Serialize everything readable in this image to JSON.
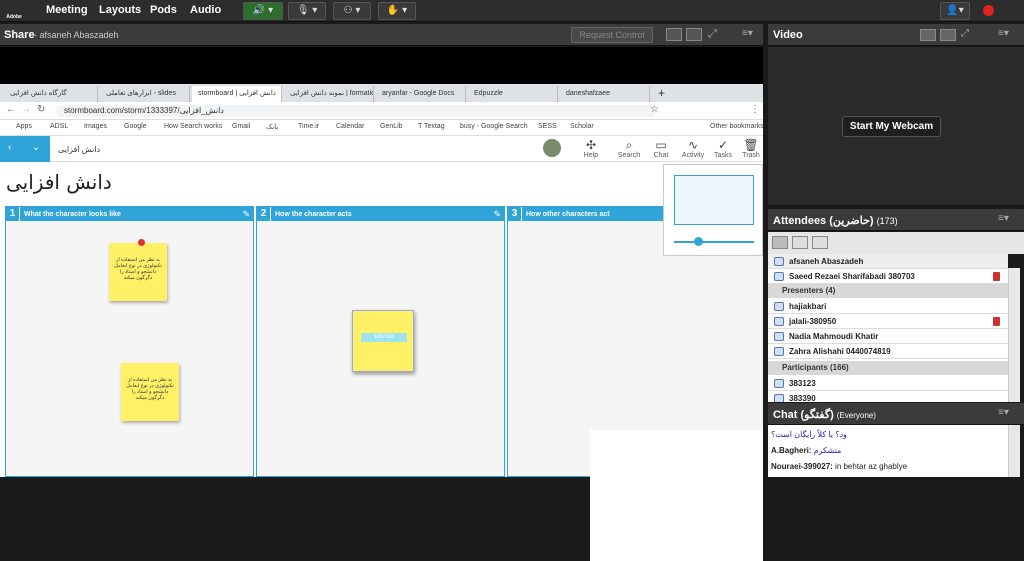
{
  "app": {
    "logo_text": "Adobe",
    "menus": [
      "Meeting",
      "Layouts",
      "Pods",
      "Audio"
    ]
  },
  "share": {
    "title": "Share",
    "presenter": "- afsaneh Abaszadeh",
    "request_control": "Request Control"
  },
  "browser": {
    "tabs": [
      "گارگاه دانش افزایی",
      "ابزارهای تعاملی - slides",
      "stormboard | دانش افزایی",
      "نمونه دانش افزایی | formation",
      "aryanfar - Google Docs",
      "Edpuzzle",
      "daneshafzaee"
    ],
    "url": "stormboard.com/storm/1333397/دانش_افزایی",
    "bookmarks": [
      "Apps",
      "ADSL",
      "Images",
      "Google",
      "How Search works",
      "Gmail",
      "بانک",
      "Time.ir",
      "Calendar",
      "GenLib",
      "T Textag",
      "busy - Google Search",
      "SESS",
      "Scholar",
      "Other bookmarks"
    ]
  },
  "stormboard": {
    "header_title": "دانش افزایی",
    "big_title": "دانش افزایی",
    "tools": [
      {
        "icon": "help-icon",
        "label": "Help"
      },
      {
        "icon": "search-icon",
        "label": "Search"
      },
      {
        "icon": "chat-icon",
        "label": "Chat"
      },
      {
        "icon": "activity-icon",
        "label": "Activity"
      },
      {
        "icon": "tasks-icon",
        "label": "Tasks"
      },
      {
        "icon": "trash-icon",
        "label": "Trash"
      }
    ],
    "columns": [
      {
        "num": "1",
        "title": "What the character looks like"
      },
      {
        "num": "2",
        "title": "How the character acts"
      },
      {
        "num": "3",
        "title": "How other characters act"
      }
    ],
    "sticky_text": "به نظر من استفاده از تکنولوژی در نوع ابعامل دانشجو و استاد را دگرگون میکند",
    "edit_text": "Edit Text"
  },
  "video": {
    "title": "Video",
    "webcam_button": "Start My Webcam"
  },
  "attendees": {
    "title": "Attendees (حاضرین)",
    "count": "(173)",
    "host": "afsaneh Abaszadeh",
    "host2": "Saeed Rezaei Sharifabadi 380703",
    "presenters_label": "Presenters (4)",
    "presenters": [
      "hajiakbari",
      "jalali-380950",
      "Nadia Mahmoudi Khatir",
      "Zahra Alishahi 0440074819"
    ],
    "participants_label": "Participants (166)",
    "participants": [
      "383123",
      "383390"
    ]
  },
  "chat": {
    "title": "Chat (گفتگو)",
    "scope": "(Everyone)",
    "lines": [
      {
        "name": "",
        "text": "ود؟ یا کلاً رایگان است؟"
      },
      {
        "name": "A.Bagheri:",
        "text": "متشکرم"
      },
      {
        "name": "Nouraei-399027:",
        "text": " in behtar az ghablye"
      }
    ]
  },
  "colors": {
    "accent": "#2fa4d8",
    "sticky": "#fff066",
    "pod_header": "#3b3b3b"
  }
}
